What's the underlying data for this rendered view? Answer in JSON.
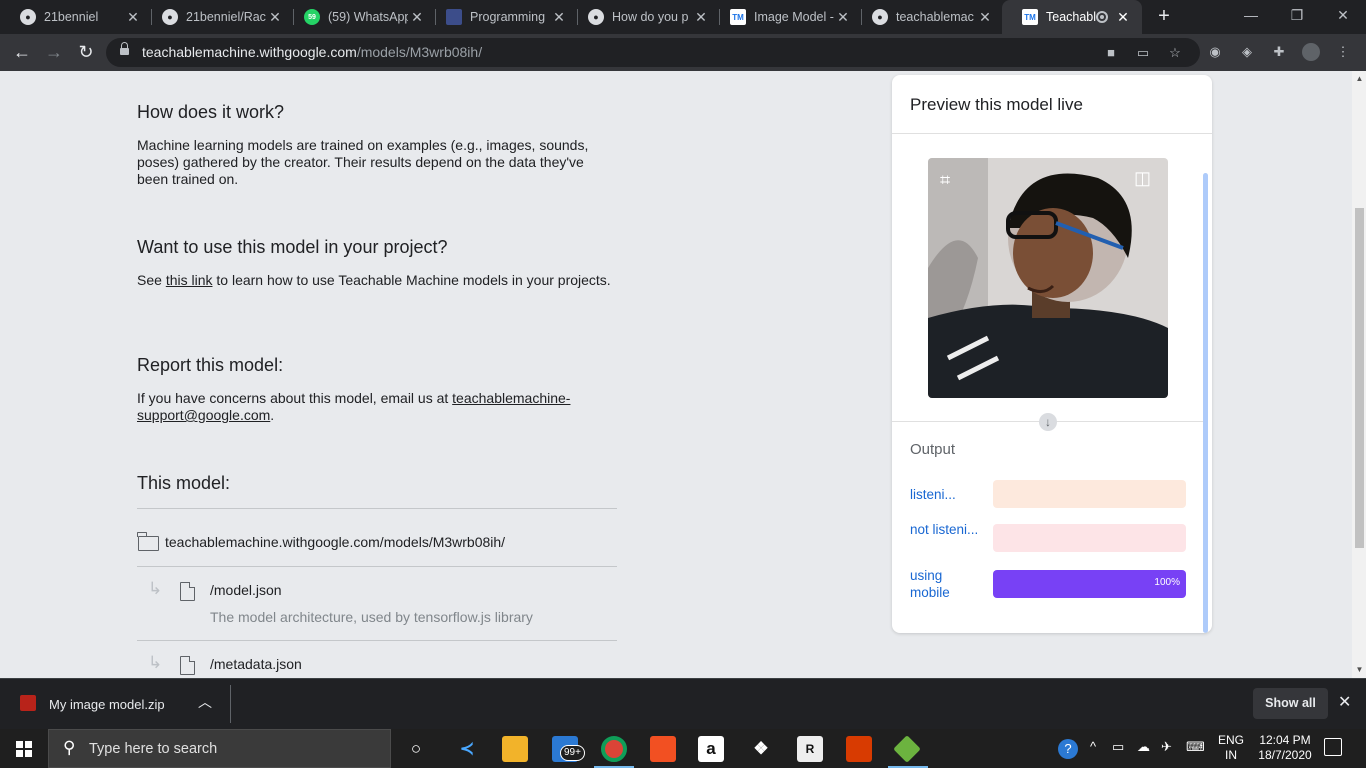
{
  "tabs": [
    {
      "title": "21benniel",
      "favicon": "github-icon"
    },
    {
      "title": "21benniel/Rac",
      "favicon": "github-icon"
    },
    {
      "title": "(59) WhatsApp",
      "favicon": "whatsapp-icon",
      "badge": "59"
    },
    {
      "title": "Programming",
      "favicon": "programming-icon"
    },
    {
      "title": "How do you p",
      "favicon": "github-icon"
    },
    {
      "title": "Image Model -",
      "favicon": "teachable-machine-icon"
    },
    {
      "title": "teachablemac",
      "favicon": "github-icon"
    },
    {
      "title": "Teachable",
      "favicon": "teachable-machine-icon",
      "active": true
    }
  ],
  "favicon_text": {
    "tm": "TM"
  },
  "address_bar": {
    "host": "teachablemachine.withgoogle.com",
    "path": "/models/M3wrb08ih/"
  },
  "content": {
    "how_heading": "How does it work?",
    "how_text": "Machine learning models are trained on examples (e.g., images, sounds, poses) gathered by the creator. Their results depend on the data they've been trained on.",
    "use_heading": "Want to use this model in your project?",
    "use_text_before": "See ",
    "use_link": "this link",
    "use_text_after": " to learn how to use Teachable Machine models in your projects.",
    "report_heading": "Report this model:",
    "report_text": "If you have concerns about this model, email us at ",
    "report_email": "teachablemachine-support@google.com",
    "report_end": ".",
    "model_heading": "This model:",
    "model_url": "teachablemachine.withgoogle.com/models/M3wrb08ih/",
    "files": [
      {
        "name": "/model.json",
        "desc": "The model architecture, used by tensorflow.js library"
      },
      {
        "name": "/metadata.json",
        "desc": ""
      }
    ]
  },
  "preview": {
    "title": "Preview this model live",
    "output_label": "Output",
    "classes": [
      {
        "name": "listeni...",
        "value": 0,
        "color": "#fde9dd",
        "fill": "#fbbc9a",
        "pct_label": ""
      },
      {
        "name": "not listeni...",
        "value": 0,
        "color": "#fde4e7",
        "fill": "#f6aebb",
        "pct_label": ""
      },
      {
        "name": "using mobile",
        "value": 1.0,
        "color": "#e8dffc",
        "fill": "#7841f5",
        "pct_label": "100%"
      }
    ]
  },
  "downloads": {
    "file": "My image model.zip",
    "show_all": "Show all"
  },
  "taskbar": {
    "search_placeholder": "Type here to search",
    "mail_badge": "99+",
    "lang": "ENG",
    "region": "IN",
    "time": "12:04 PM",
    "date": "18/7/2020"
  }
}
